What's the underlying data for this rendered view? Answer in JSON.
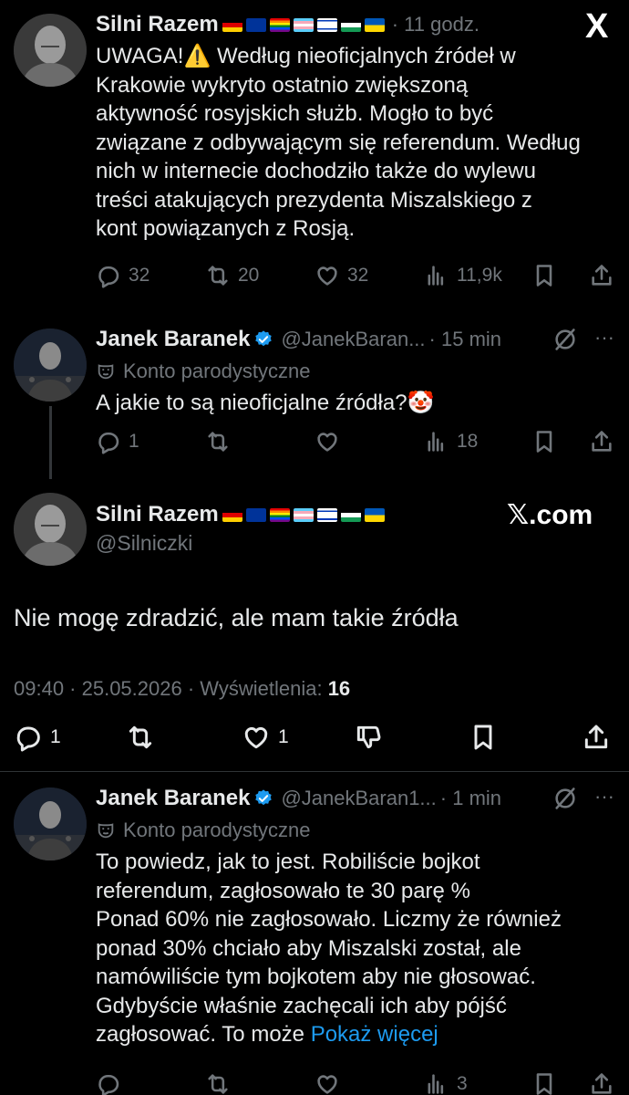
{
  "watermark": "X",
  "watermark_domain": "𝕏.com",
  "tweet1": {
    "author": "Silni Razem",
    "time": "· 11 godz.",
    "lines": [
      "UWAGA!⚠️ Według nieoficjalnych źródeł w",
      "Krakowie wykryto ostatnio zwiększoną",
      "aktywność rosyjskich służb. Mogło to być",
      "związane z odbywającym się referendum. Według",
      "nich w internecie dochodziło także do wylewu",
      "treści atakujących prezydenta Miszalskiego z",
      "kont powiązanych z Rosją."
    ],
    "replies": "32",
    "reposts": "20",
    "likes": "32",
    "views": "11,9k"
  },
  "tweet2": {
    "author": "Janek Baranek",
    "handle": "@JanekBaran...",
    "time": "· 15 min",
    "parody_label": "Konto parodystyczne",
    "text": "A jakie to są nieoficjalne źródła?🤡",
    "replies": "1",
    "views": "18",
    "more": "···"
  },
  "main": {
    "author": "Silni Razem",
    "handle": "@Silniczki",
    "text": "Nie mogę zdradzić, ale mam takie źródła",
    "meta_time": "09:40 · 25.05.2026 · Wyświetlenia:",
    "views": "16",
    "replies": "1",
    "likes": "1"
  },
  "tweet4": {
    "author": "Janek Baranek",
    "handle": "@JanekBaran1...",
    "time": "· 1 min",
    "parody_label": "Konto parodystyczne",
    "lines": [
      "To powiedz, jak to jest. Robiliście bojkot",
      "referendum, zagłosowało te 30 parę %",
      "Ponad 60% nie zagłosowało. Liczmy że również",
      "ponad 30% chciało aby Miszalski został, ale",
      "namówiliście tym bojkotem aby nie głosować.",
      "Gdybyście właśnie zachęcali ich aby pójść"
    ],
    "last_line": "zagłosować. To może",
    "show_more": "Pokaż więcej",
    "views": "3",
    "more": "···"
  },
  "colors": {
    "accent": "#1d9bf0",
    "muted": "#71767b",
    "text": "#e7e9ea",
    "background": "#000000"
  }
}
